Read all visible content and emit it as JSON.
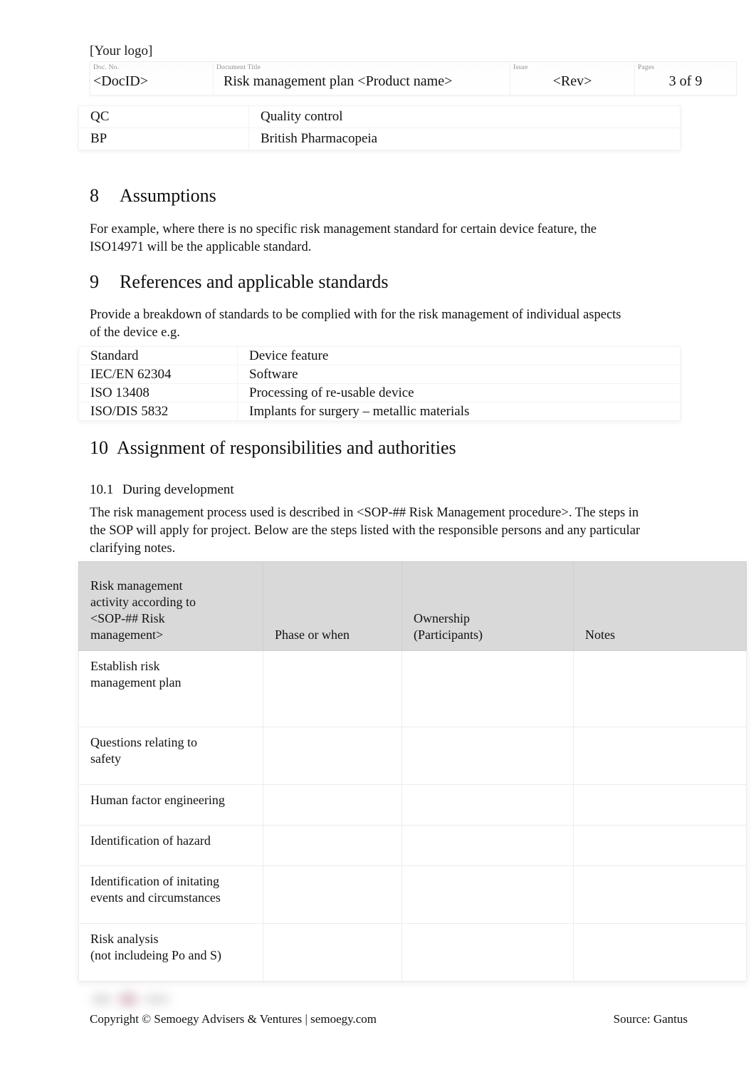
{
  "header": {
    "logo_placeholder": "[Your logo]",
    "fields": [
      {
        "label": "Doc. No.",
        "value": "<DocID>"
      },
      {
        "label": "Document Title",
        "value": "Risk management plan <Product name>"
      },
      {
        "label": "Issue",
        "value": "<Rev>"
      },
      {
        "label": "Pages",
        "value": "3 of 9"
      }
    ]
  },
  "abbreviations": {
    "rows": [
      {
        "abbr": "QC",
        "meaning": "Quality control"
      },
      {
        "abbr": "BP",
        "meaning": "British Pharmacopeia"
      }
    ]
  },
  "section_assumptions": {
    "number": "8",
    "title": "Assumptions",
    "body_line1": "For example, where there is no specific risk management standard for certain device feature, the",
    "body_line2": "ISO14971 will be the applicable standard."
  },
  "section_references": {
    "number": "9",
    "title": "References and applicable standards",
    "body_line1": "Provide a breakdown of standards to be complied with for the risk management of individual",
    "body_line2": "aspects of the device e.g.",
    "table": {
      "header": {
        "col1": "Standard",
        "col2": "Device feature"
      },
      "rows": [
        {
          "standard": "IEC/EN 62304",
          "feature": "Software"
        },
        {
          "standard": "ISO 13408",
          "feature": "Processing of re-usable device"
        },
        {
          "standard": "ISO/DIS 5832",
          "feature": "Implants for surgery – metallic materials"
        }
      ]
    }
  },
  "section_responsibilities": {
    "number": "10",
    "title": "Assignment of responsibilities and authorities",
    "subsection": {
      "number": "10.1",
      "title": "During  development",
      "body_line1": "The risk management process used is described in <SOP-## Risk Management procedure>.",
      "body_line2": "The steps in the SOP will apply for project. Below are the steps listed with the responsible",
      "body_line3": "persons and any particular clarifying notes."
    },
    "table": {
      "headers": {
        "col1_line1": "Risk management",
        "col1_line2": "activity according to",
        "col1_line3": "<SOP-## Risk",
        "col1_line4": "management>",
        "col2": "Phase or when",
        "col3_line1": "Ownership",
        "col3_line2": "(Participants)",
        "col4": "Notes"
      },
      "rows": [
        {
          "activity_line1": "Establish risk",
          "activity_line2": "management plan",
          "phase": "",
          "ownership": "",
          "notes": ""
        },
        {
          "activity_line1": "Questions relating to",
          "activity_line2": "safety",
          "phase": "",
          "ownership": "",
          "notes": ""
        },
        {
          "activity_line1": "Human factor engineering",
          "activity_line2": "",
          "phase": "",
          "ownership": "",
          "notes": ""
        },
        {
          "activity_line1": "Identification of hazard",
          "activity_line2": "",
          "phase": "",
          "ownership": "",
          "notes": ""
        },
        {
          "activity_line1": "Identification of initating",
          "activity_line2": "events and circumstances",
          "phase": "",
          "ownership": "",
          "notes": ""
        },
        {
          "activity_line1": "Risk analysis",
          "activity_line2": "(not includeing    Po and S)",
          "phase": "",
          "ownership": "",
          "notes": ""
        }
      ]
    }
  },
  "footer": {
    "copyright": "Copyright © Semoegy Advisers & Ventures | semoegy.com",
    "source": "Source: Gantus"
  }
}
